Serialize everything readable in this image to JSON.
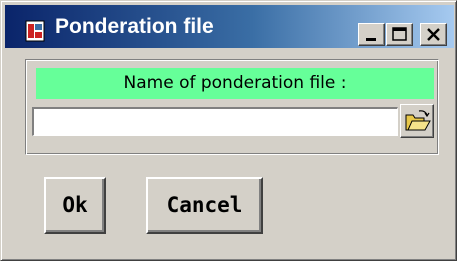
{
  "window": {
    "title": "Ponderation file",
    "icon": "app-icon",
    "controls": [
      "minimize-icon",
      "maximize-icon",
      "close-icon"
    ]
  },
  "group": {
    "label": "Name of ponderation file :",
    "input_value": "",
    "browse_icon": "open-folder-icon"
  },
  "buttons": {
    "ok_label": "Ok",
    "cancel_label": "Cancel"
  },
  "colors": {
    "titlebar_start": "#0a246a",
    "titlebar_end": "#a6caf0",
    "label_background": "#66ff99",
    "window_background": "#d4d0c8"
  }
}
